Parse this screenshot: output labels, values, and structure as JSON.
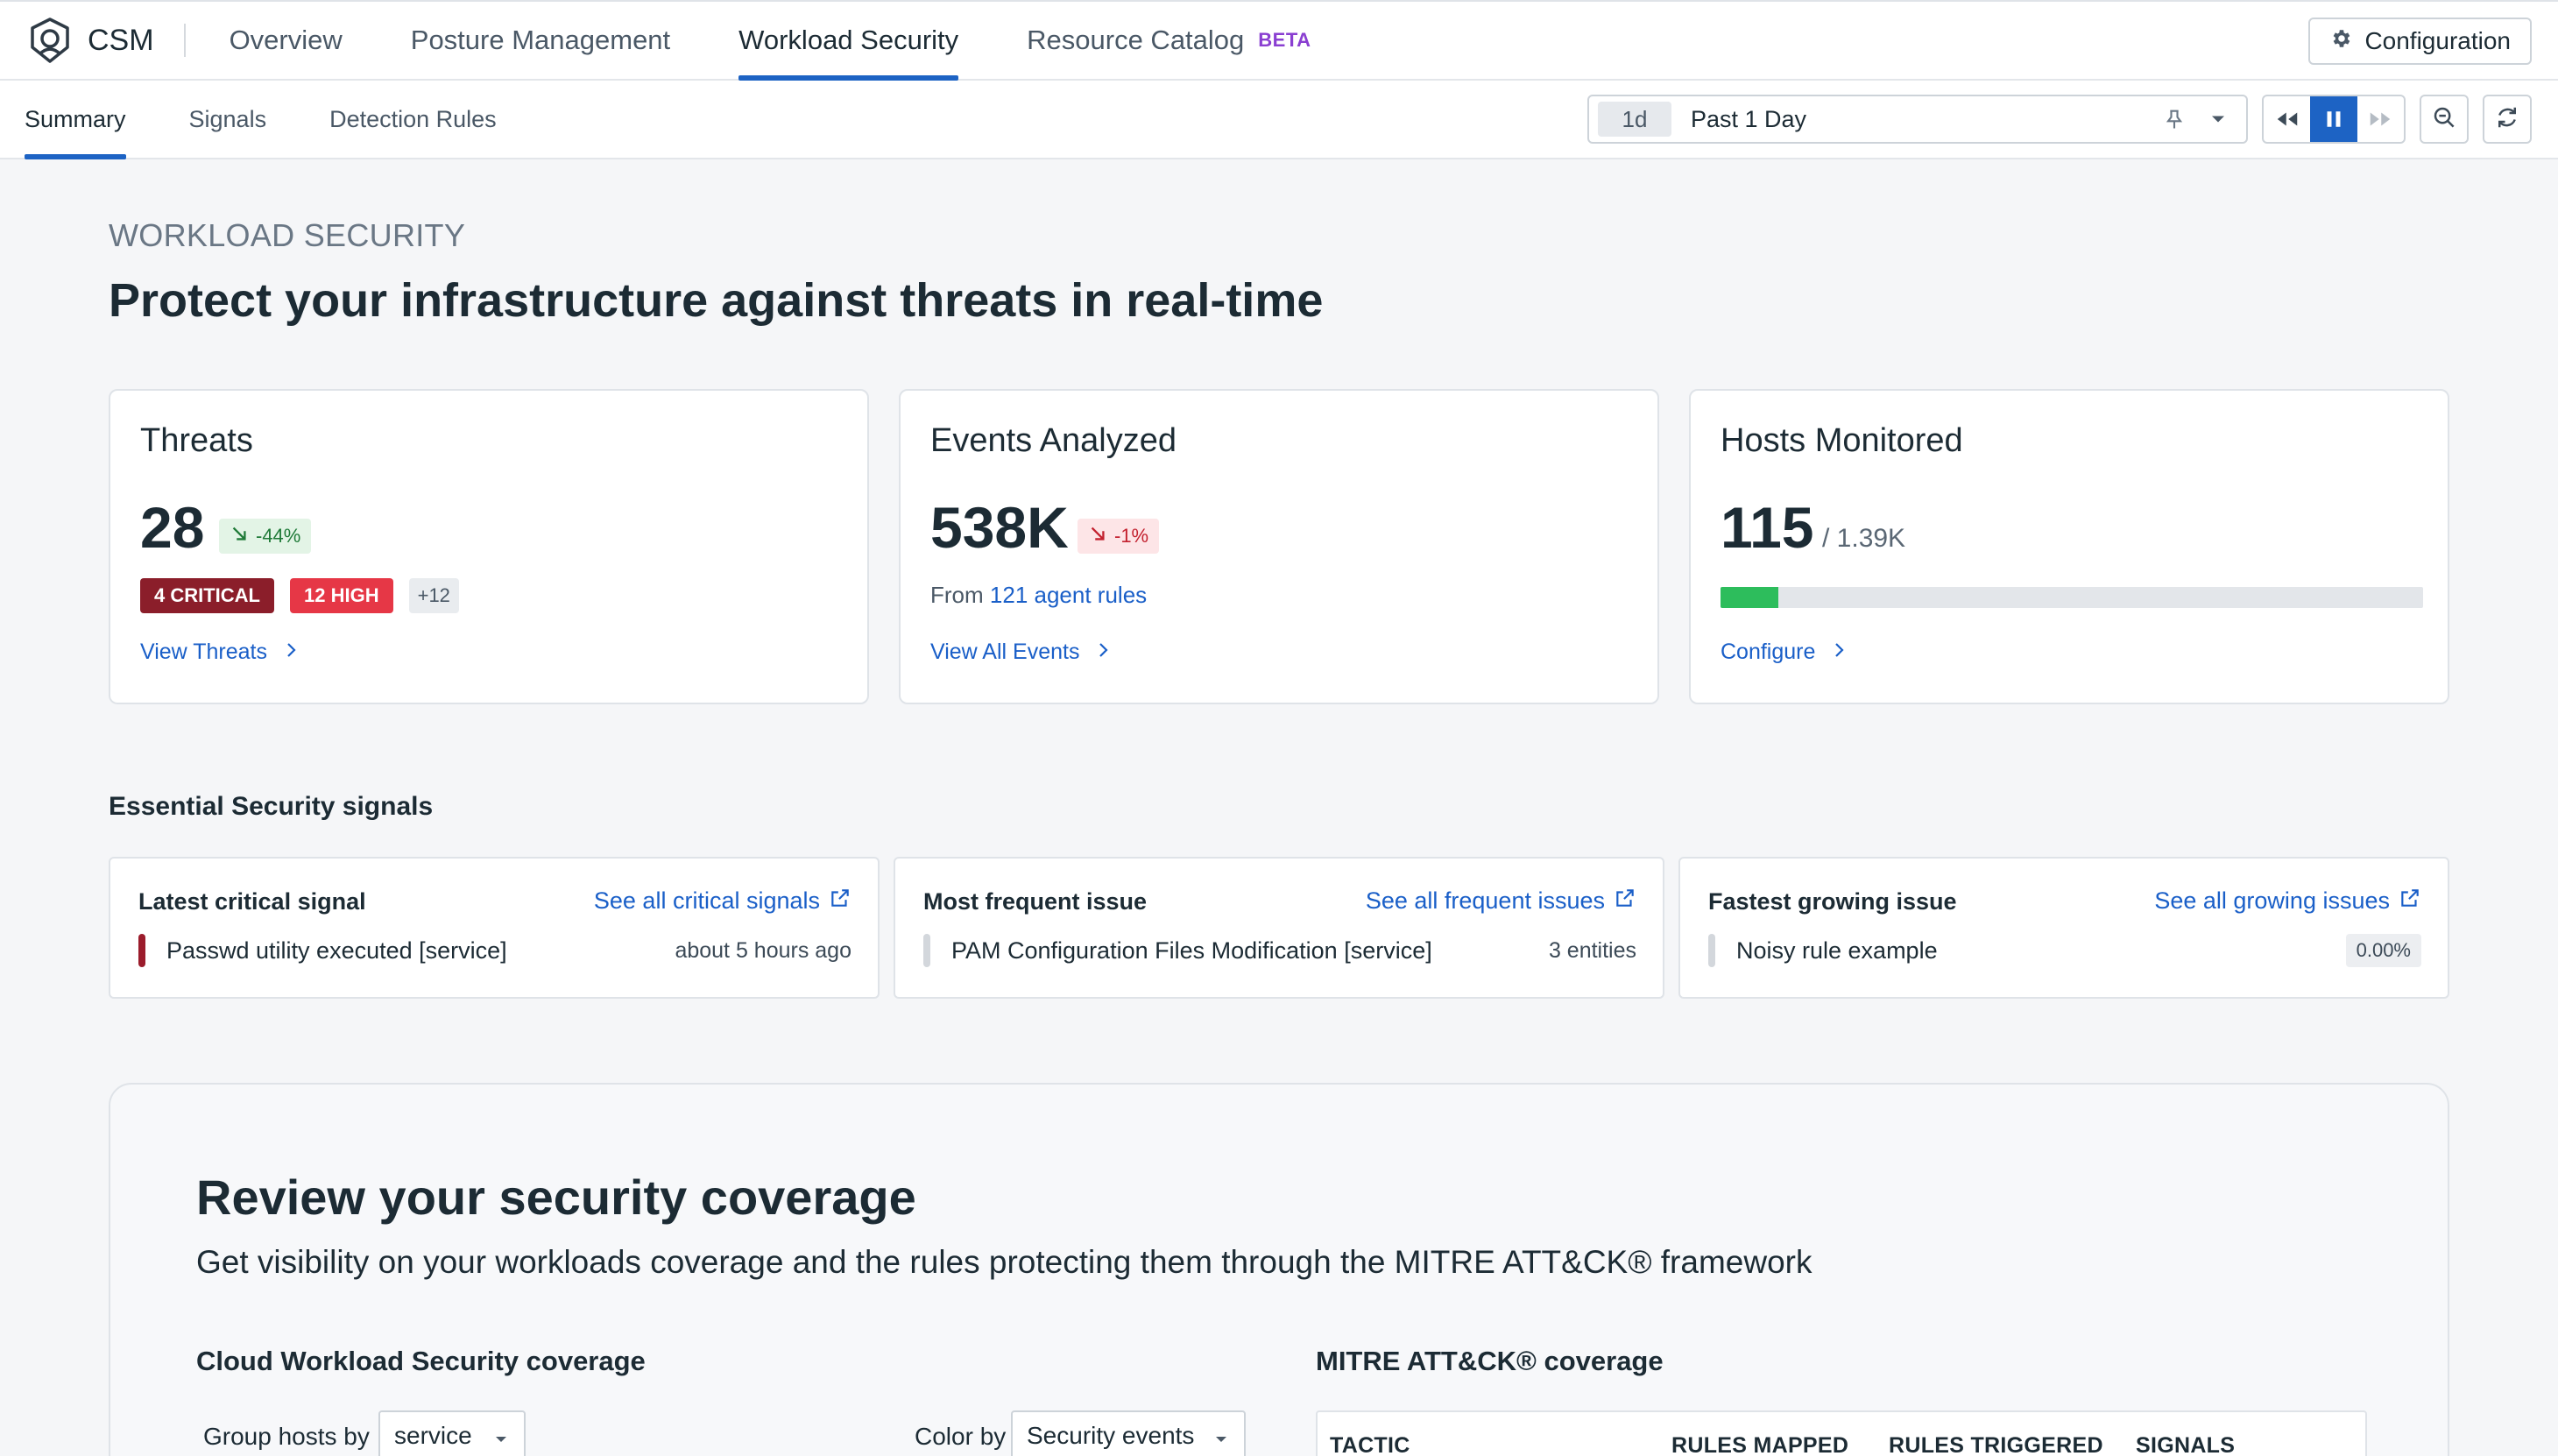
{
  "app": {
    "name": "CSM",
    "nav": [
      {
        "label": "Overview",
        "active": false
      },
      {
        "label": "Posture Management",
        "active": false
      },
      {
        "label": "Workload Security",
        "active": true
      },
      {
        "label": "Resource Catalog",
        "active": false,
        "badge": "BETA"
      }
    ],
    "config_label": "Configuration"
  },
  "subnav": {
    "tabs": [
      {
        "label": "Summary",
        "active": true
      },
      {
        "label": "Signals",
        "active": false
      },
      {
        "label": "Detection Rules",
        "active": false
      }
    ],
    "time_chip": "1d",
    "time_label": "Past 1 Day"
  },
  "page": {
    "eyebrow": "WORKLOAD SECURITY",
    "headline": "Protect your infrastructure against threats in real-time"
  },
  "cards": {
    "threats": {
      "title": "Threats",
      "value": "28",
      "delta": "-44%",
      "critical": "4 CRITICAL",
      "high": "12 HIGH",
      "more": "+12",
      "link": "View Threats"
    },
    "events": {
      "title": "Events Analyzed",
      "value": "538K",
      "delta": "-1%",
      "from_prefix": "From",
      "from_link": "121 agent rules",
      "link": "View All Events"
    },
    "hosts": {
      "title": "Hosts Monitored",
      "value": "115",
      "total": "/ 1.39K",
      "fill_fraction": 0.0827,
      "link": "Configure"
    }
  },
  "signals": {
    "section_title": "Essential Security signals",
    "items": [
      {
        "heading": "Latest critical signal",
        "link": "See all critical signals",
        "text": "Passwd utility executed [service]",
        "meta": "about 5 hours ago",
        "mark_color": "#9b1c2c"
      },
      {
        "heading": "Most frequent issue",
        "link": "See all frequent issues",
        "text": "PAM Configuration Files Modification [service]",
        "meta": "3 entities",
        "mark_color": "#d3d7dc"
      },
      {
        "heading": "Fastest growing issue",
        "link": "See all growing issues",
        "text": "Noisy rule example",
        "meta": "0.00%",
        "mark_color": "#d3d7dc"
      }
    ]
  },
  "coverage": {
    "title": "Review your security coverage",
    "subtitle": "Get visibility on your workloads coverage and the rules protecting them through the MITRE ATT&CK® framework",
    "cws_title": "Cloud Workload Security coverage",
    "group_label": "Group hosts by",
    "group_value": "service",
    "color_label": "Color by",
    "color_value": "Security events",
    "mitre_title": "MITRE ATT&CK® coverage",
    "columns": [
      "TACTIC",
      "RULES MAPPED",
      "RULES TRIGGERED",
      "SIGNALS GENERATED"
    ]
  },
  "colors": {
    "accent": "#1d63c4",
    "link": "#1a5fc8",
    "critical": "#8b1e2a",
    "high": "#e63746",
    "beta": "#8a3fd1",
    "hosts_fill": "#2dbd5c"
  }
}
